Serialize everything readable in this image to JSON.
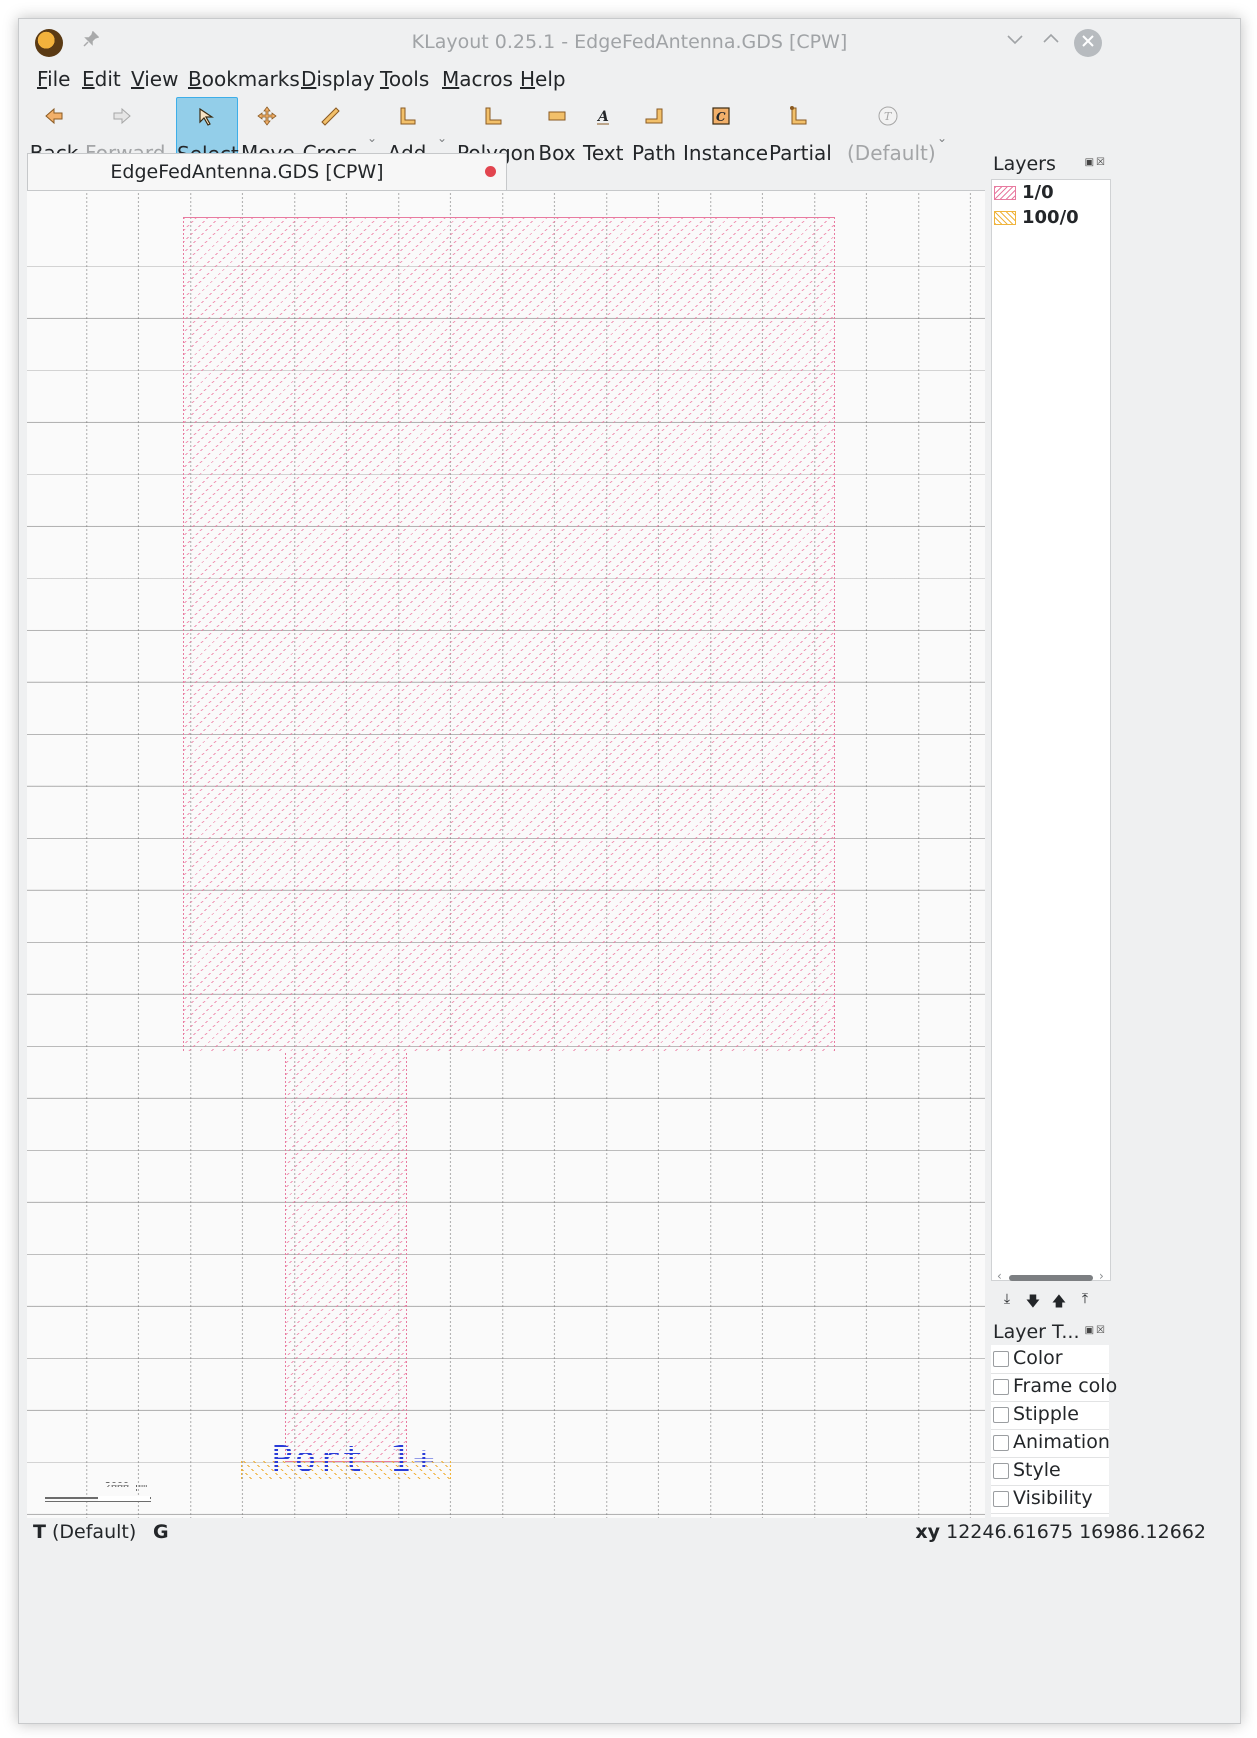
{
  "window": {
    "title": "KLayout 0.25.1 - EdgeFedAntenna.GDS [CPW]"
  },
  "icons": {
    "app": "klayout-logo-icon",
    "pin": "pin-icon",
    "minimize": "chevron-down-icon",
    "maximize": "chevron-up-icon",
    "close": "close-icon"
  },
  "menu": [
    "File",
    "Edit",
    "View",
    "Bookmarks",
    "Display",
    "Tools",
    "Macros",
    "Help"
  ],
  "toolbar": {
    "back": "Back",
    "forward": "Forward",
    "select": "Select",
    "move": "Move",
    "cross": "Cross",
    "add": "Add",
    "polygon": "Polygon",
    "box": "Box",
    "text": "Text",
    "path": "Path",
    "instance": "Instance",
    "partial": "Partial",
    "default": "(Default)"
  },
  "document_tab": {
    "label": "EdgeFedAntenna.GDS [CPW]"
  },
  "canvas": {
    "port_text": "Port 1+",
    "scale_label": "2000 µm"
  },
  "layers": {
    "title": "Layers",
    "items": [
      {
        "name": "1/0",
        "color": "#e87ba0"
      },
      {
        "name": "100/0",
        "color": "#f0b43c"
      }
    ]
  },
  "layer_toolbox": {
    "title": "Layer T...",
    "options": [
      "Color",
      "Frame colo",
      "Stipple",
      "Animation",
      "Style",
      "Visibility"
    ]
  },
  "status": {
    "mode_letter": "T",
    "mode_text": "(Default)",
    "grid": "G",
    "xy_label": "xy",
    "xy_value": "12246.61675 16986.12662"
  },
  "colors": {
    "accent": "#3daee9",
    "select_bg": "#93cee9",
    "shape_pink": "#e87ba0",
    "shape_orange": "#f0b43c",
    "port_text": "#2a3cd8"
  }
}
